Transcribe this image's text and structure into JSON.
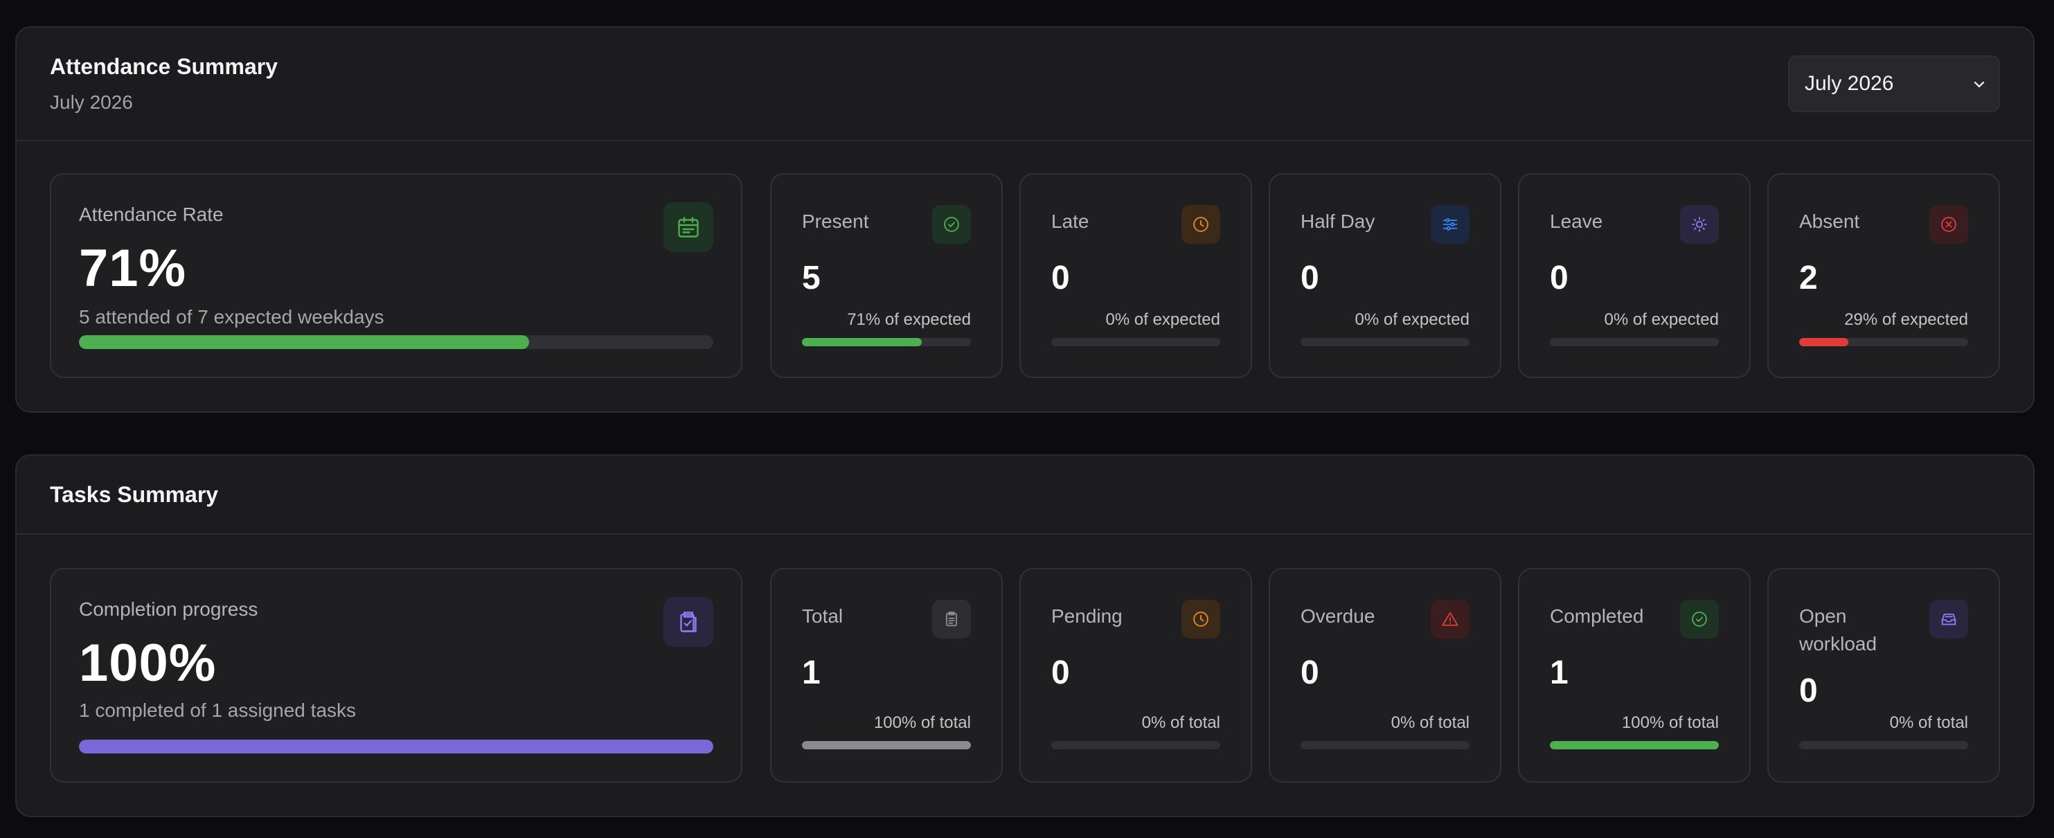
{
  "attendance": {
    "title": "Attendance Summary",
    "subtitle": "July 2026",
    "month_select": {
      "value": "July 2026",
      "icon": "chevron-down-icon"
    },
    "rate": {
      "label": "Attendance Rate",
      "value": "71%",
      "detail": "5 attended of 7 expected weekdays",
      "progress": 0.71,
      "color": "#4caf50",
      "icon": "calendar-icon"
    },
    "stats": [
      {
        "label": "Present",
        "value": "5",
        "pct": "71% of expected",
        "progress": 0.71,
        "color": "#4caf50",
        "icon": "check-circle-icon"
      },
      {
        "label": "Late",
        "value": "0",
        "pct": "0% of expected",
        "progress": 0,
        "color": "#e08a2c",
        "icon": "clock-icon"
      },
      {
        "label": "Half Day",
        "value": "0",
        "pct": "0% of expected",
        "progress": 0,
        "color": "#3b82f6",
        "icon": "sliders-icon"
      },
      {
        "label": "Leave",
        "value": "0",
        "pct": "0% of expected",
        "progress": 0,
        "color": "#8b7cf6",
        "icon": "sun-icon"
      },
      {
        "label": "Absent",
        "value": "2",
        "pct": "29% of expected",
        "progress": 0.29,
        "color": "#e03a3a",
        "icon": "x-circle-icon"
      }
    ]
  },
  "tasks": {
    "title": "Tasks Summary",
    "completion": {
      "label": "Completion progress",
      "value": "100%",
      "detail": "1 completed of 1 assigned tasks",
      "progress": 1.0,
      "color": "#7b68d8",
      "icon": "clipboard-check-icon"
    },
    "stats": [
      {
        "label": "Total",
        "value": "1",
        "pct": "100% of total",
        "progress": 1.0,
        "color": "#8a8a90",
        "icon": "clipboard-icon"
      },
      {
        "label": "Pending",
        "value": "0",
        "pct": "0% of total",
        "progress": 0,
        "color": "#e08a2c",
        "icon": "clock-icon"
      },
      {
        "label": "Overdue",
        "value": "0",
        "pct": "0% of total",
        "progress": 0,
        "color": "#e03a3a",
        "icon": "alert-triangle-icon"
      },
      {
        "label": "Completed",
        "value": "1",
        "pct": "100% of total",
        "progress": 1.0,
        "color": "#4caf50",
        "icon": "check-circle-icon"
      },
      {
        "label": "Open workload",
        "value": "0",
        "pct": "0% of total",
        "progress": 0,
        "color": "#8b7cf6",
        "icon": "inbox-icon"
      }
    ]
  }
}
